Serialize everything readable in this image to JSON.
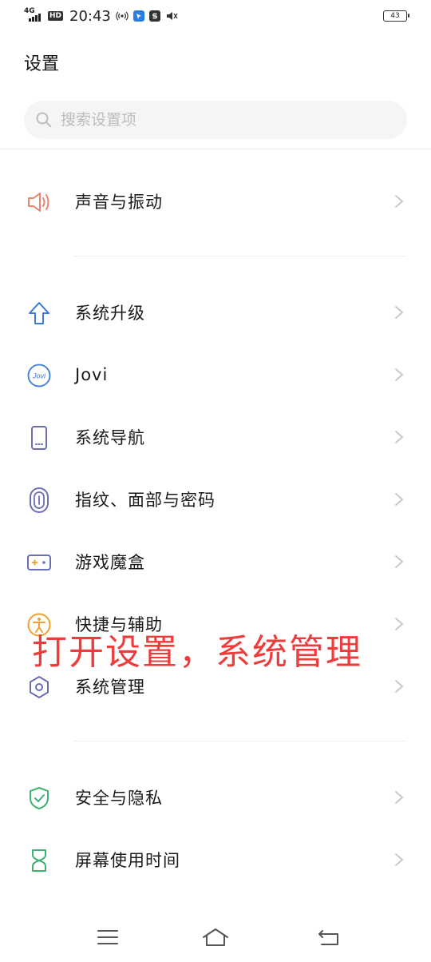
{
  "status_bar": {
    "network": "4G",
    "hd_badge": "HD",
    "time": "20:43",
    "battery": "43"
  },
  "header": {
    "title": "设置",
    "search_placeholder": "搜索设置项"
  },
  "settings": {
    "items": [
      {
        "label": "声音与振动",
        "icon": "speaker-icon"
      },
      {
        "label": "系统升级",
        "icon": "arrow-up-icon"
      },
      {
        "label": "Jovi",
        "icon": "jovi-icon"
      },
      {
        "label": "系统导航",
        "icon": "phone-icon"
      },
      {
        "label": "指纹、面部与密码",
        "icon": "fingerprint-icon"
      },
      {
        "label": "游戏魔盒",
        "icon": "gamepad-icon"
      },
      {
        "label": "快捷与辅助",
        "icon": "accessibility-icon"
      },
      {
        "label": "系统管理",
        "icon": "hexagon-gear-icon"
      },
      {
        "label": "安全与隐私",
        "icon": "shield-check-icon"
      },
      {
        "label": "屏幕使用时间",
        "icon": "hourglass-icon"
      }
    ],
    "jovi_icon_text": "Jovi"
  },
  "overlay": {
    "text": "打开设置，系统管理"
  },
  "colors": {
    "overlay": "#ee3b3b",
    "icon_blue": "#3a7bd5",
    "icon_speaker": "#e8856a",
    "icon_purple": "#6a6fb5",
    "icon_orange": "#f0a030",
    "icon_green": "#3cb371",
    "chevron": "#c8c8c8"
  },
  "nav_bar": {
    "menu": "menu-icon",
    "home": "home-icon",
    "back": "back-icon"
  }
}
